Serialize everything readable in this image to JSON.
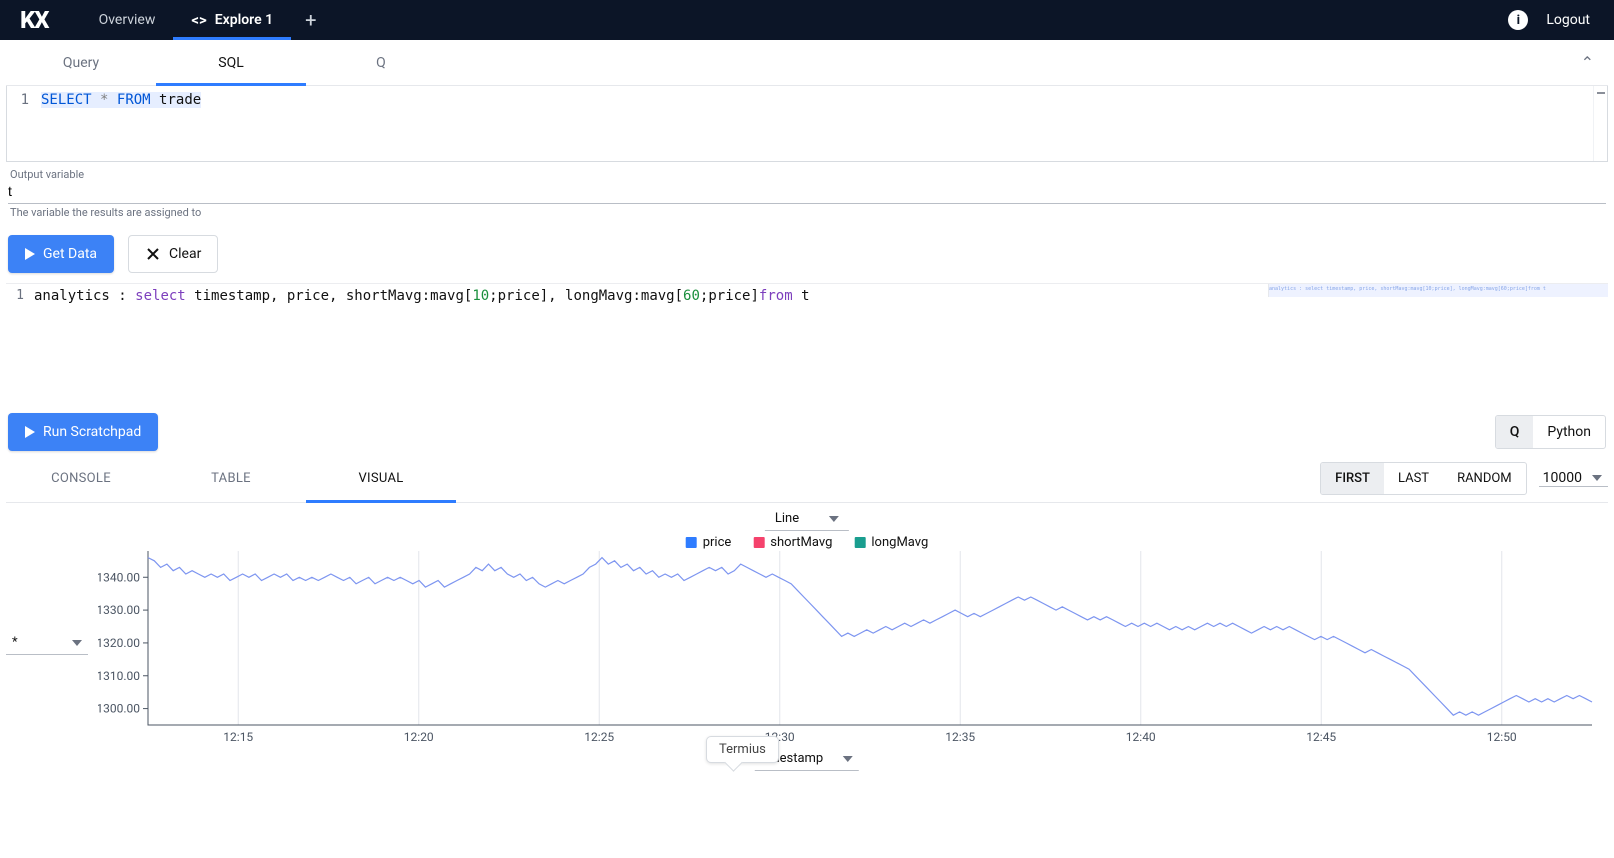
{
  "nav": {
    "logo": "KX",
    "tabs": [
      {
        "label": "Overview",
        "active": false,
        "icon": false
      },
      {
        "label": "Explore 1",
        "active": true,
        "icon": true
      }
    ],
    "logout": "Logout"
  },
  "lang_tabs": {
    "items": [
      "Query",
      "SQL",
      "Q"
    ],
    "active_index": 1
  },
  "sql_editor": {
    "line_no": "1",
    "tokens": {
      "select": "SELECT",
      "star": "*",
      "from": "FROM",
      "table": "trade"
    }
  },
  "output_var": {
    "label": "Output variable",
    "value": "t",
    "help": "The variable the results are assigned to"
  },
  "buttons": {
    "get_data": "Get Data",
    "clear": "Clear"
  },
  "scratch": {
    "line_no": "1",
    "p1": "analytics : ",
    "p2": "select",
    "p3": " timestamp, price, shortMavg:mavg[",
    "n1": "10",
    "p4": ";price], longMavg:mavg[",
    "n2": "60",
    "p5": ";price]",
    "p6": "from",
    "p7": " t",
    "minimap": "analytics : select timestamp, price, shortMavg:mavg[10;price], longMavg:mavg[60;price]from t"
  },
  "run": {
    "label": "Run Scratchpad",
    "lang_toggle": [
      "Q",
      "Python"
    ],
    "active_index": 0
  },
  "results": {
    "tabs": [
      "CONSOLE",
      "TABLE",
      "VISUAL"
    ],
    "active_index": 2,
    "sample": [
      "FIRST",
      "LAST",
      "RANDOM"
    ],
    "sample_active_index": 0,
    "row_count": "10000"
  },
  "chart": {
    "type_sel": "Line",
    "legend": [
      {
        "label": "price",
        "color": "#2e7cff"
      },
      {
        "label": "shortMavg",
        "color": "#f5426c"
      },
      {
        "label": "longMavg",
        "color": "#1a9e8f"
      }
    ],
    "yaxis_sel": "*",
    "xaxis_sel": "timestamp",
    "termius": "Termius"
  },
  "chart_data": {
    "type": "line",
    "title": "",
    "xlabel": "timestamp",
    "ylabel": "",
    "x_tick_labels": [
      "12:15",
      "12:20",
      "12:25",
      "12:30",
      "12:35",
      "12:40",
      "12:45",
      "12:50"
    ],
    "ylim": [
      1295,
      1348
    ],
    "y_ticks": [
      1300,
      1310,
      1320,
      1330,
      1340
    ],
    "series": [
      {
        "name": "price",
        "color": "#7d95f0",
        "values": [
          1346,
          1345,
          1343,
          1344,
          1342,
          1343,
          1341,
          1342,
          1341,
          1340,
          1341,
          1340,
          1341,
          1339,
          1340,
          1341,
          1340,
          1341,
          1339,
          1340,
          1341,
          1340,
          1341,
          1339,
          1340,
          1339,
          1340,
          1339,
          1340,
          1341,
          1340,
          1339,
          1340,
          1338,
          1339,
          1340,
          1338,
          1339,
          1340,
          1339,
          1340,
          1339,
          1338,
          1339,
          1337,
          1338,
          1339,
          1337,
          1338,
          1339,
          1340,
          1341,
          1343,
          1342,
          1344,
          1342,
          1343,
          1341,
          1340,
          1341,
          1339,
          1340,
          1338,
          1337,
          1338,
          1339,
          1338,
          1339,
          1340,
          1341,
          1343,
          1344,
          1346,
          1344,
          1345,
          1343,
          1344,
          1342,
          1343,
          1341,
          1342,
          1340,
          1341,
          1340,
          1341,
          1339,
          1340,
          1341,
          1342,
          1343,
          1342,
          1343,
          1341,
          1342,
          1344,
          1343,
          1342,
          1341,
          1340,
          1341,
          1340,
          1339,
          1338,
          1336,
          1334,
          1332,
          1330,
          1328,
          1326,
          1324,
          1322,
          1323,
          1322,
          1323,
          1324,
          1323,
          1324,
          1325,
          1324,
          1325,
          1326,
          1325,
          1326,
          1327,
          1326,
          1327,
          1328,
          1329,
          1330,
          1329,
          1328,
          1329,
          1328,
          1329,
          1330,
          1331,
          1332,
          1333,
          1334,
          1333,
          1334,
          1333,
          1332,
          1331,
          1330,
          1331,
          1330,
          1329,
          1328,
          1327,
          1328,
          1327,
          1328,
          1327,
          1326,
          1325,
          1326,
          1325,
          1326,
          1325,
          1326,
          1325,
          1324,
          1325,
          1324,
          1325,
          1324,
          1325,
          1326,
          1325,
          1326,
          1325,
          1326,
          1325,
          1324,
          1323,
          1324,
          1325,
          1324,
          1325,
          1324,
          1325,
          1324,
          1323,
          1322,
          1321,
          1322,
          1321,
          1322,
          1321,
          1320,
          1319,
          1318,
          1317,
          1318,
          1317,
          1316,
          1315,
          1314,
          1313,
          1312,
          1310,
          1308,
          1306,
          1304,
          1302,
          1300,
          1298,
          1299,
          1298,
          1299,
          1298,
          1299,
          1300,
          1301,
          1302,
          1303,
          1304,
          1303,
          1302,
          1303,
          1302,
          1303,
          1302,
          1303,
          1304,
          1303,
          1304,
          1303,
          1302
        ]
      },
      {
        "name": "shortMavg",
        "color": "#f5426c",
        "values": []
      },
      {
        "name": "longMavg",
        "color": "#1a9e8f",
        "values": []
      }
    ]
  }
}
